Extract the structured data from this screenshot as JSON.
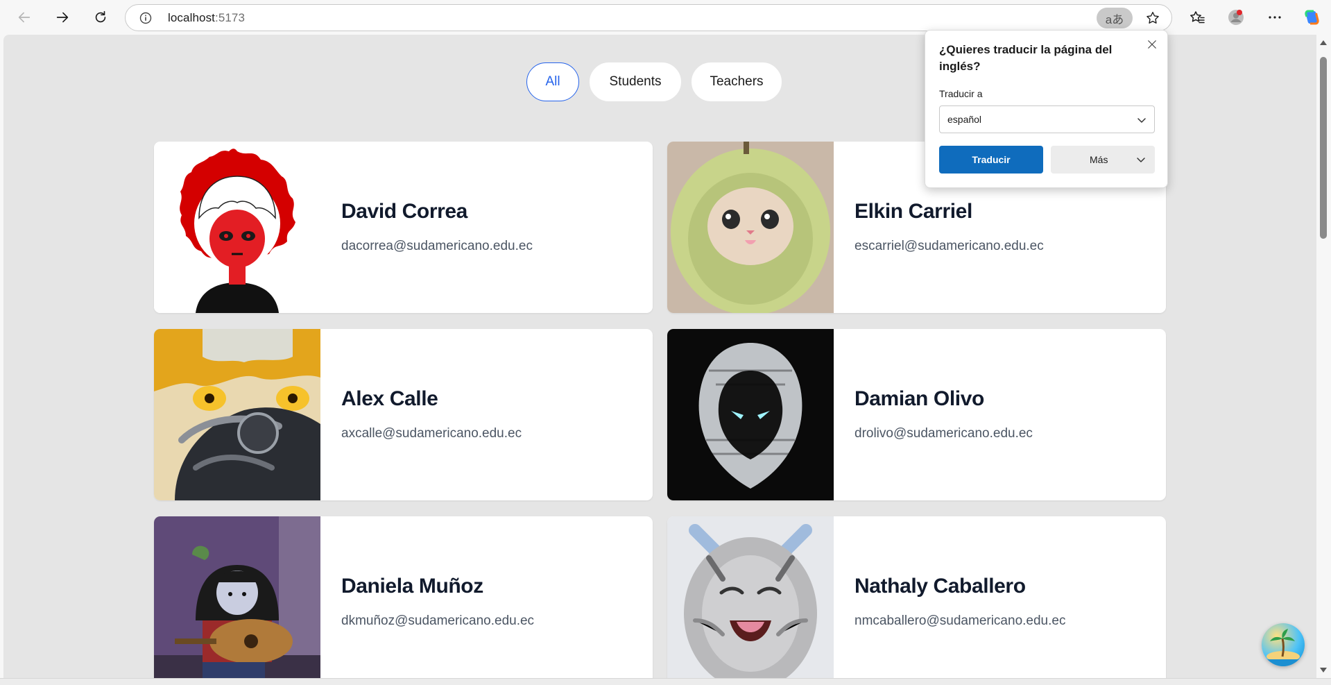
{
  "browser": {
    "url_host": "localhost",
    "url_port": ":5173",
    "translate_chip_glyph": "aあ"
  },
  "filters": [
    {
      "label": "All",
      "active": true
    },
    {
      "label": "Students",
      "active": false
    },
    {
      "label": "Teachers",
      "active": false
    }
  ],
  "people": [
    {
      "name": "David Correa",
      "email": "dacorrea@sudamericano.edu.ec",
      "avatar": "red-anime-character"
    },
    {
      "name": "Elkin Carriel",
      "email": "escarriel@sudamericano.edu.ec",
      "avatar": "cat-avocado-hat"
    },
    {
      "name": "Alex Calle",
      "email": "axcalle@sudamericano.edu.ec",
      "avatar": "anime-blond-automail-arm"
    },
    {
      "name": "Damian Olivo",
      "email": "drolivo@sudamericano.edu.ec",
      "avatar": "moon-knight-logo"
    },
    {
      "name": "Daniela Muñoz",
      "email": "dkmuñoz@sudamericano.edu.ec",
      "avatar": "cartoon-girl-guitar"
    },
    {
      "name": "Nathaly Caballero",
      "email": "nmcaballero@sudamericano.edu.ec",
      "avatar": "laughing-cat"
    }
  ],
  "translate_popup": {
    "title": "¿Quieres traducir la página del inglés?",
    "label": "Traducir a",
    "language": "español",
    "translate_button": "Traducir",
    "more_button": "Más"
  },
  "colors": {
    "accent": "#2563eb",
    "page_bg": "#e5e5e5",
    "primary_button": "#0f6cbd",
    "name_text": "#111a2c",
    "email_text": "#4b5563"
  }
}
